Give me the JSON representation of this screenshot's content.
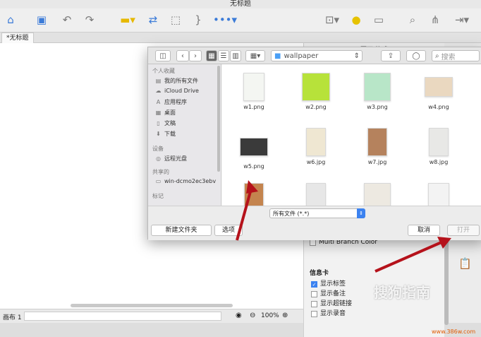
{
  "app": {
    "title": "无标题"
  },
  "doc_tab": {
    "label": "*无标题"
  },
  "status": {
    "canvas_label": "画布 1",
    "zoom": "100%"
  },
  "right_panel": {
    "heading_partial": "页面 格式",
    "branch_option": "Multi Branch Color",
    "info_card_title": "信息卡",
    "checkboxes": [
      {
        "label": "显示标签",
        "checked": true
      },
      {
        "label": "显示备注",
        "checked": false
      },
      {
        "label": "显示超链接",
        "checked": false
      },
      {
        "label": "显示录音",
        "checked": false
      }
    ]
  },
  "dialog": {
    "location": "wallpaper",
    "search_placeholder": "搜索",
    "sidebar": {
      "favorites_header": "个人收藏",
      "favorites": [
        "我的所有文件",
        "iCloud Drive",
        "应用程序",
        "桌面",
        "文稿",
        "下载"
      ],
      "devices_header": "设备",
      "devices": [
        "远程光盘"
      ],
      "shared_header": "共享的",
      "shared": [
        "win-dcmo2ec3ebv"
      ],
      "tags_header": "标记"
    },
    "files": [
      {
        "name": "w1.png",
        "color": "#f4f6f2"
      },
      {
        "name": "w2.png",
        "color": "#b7e23a"
      },
      {
        "name": "w3.png",
        "color": "#b8e6c8"
      },
      {
        "name": "w4.png",
        "color": "#ead8c0"
      },
      {
        "name": "w5.png",
        "color": "#3a3a3a"
      },
      {
        "name": "w6.jpg",
        "color": "#efe7d2"
      },
      {
        "name": "w7.jpg",
        "color": "#b5825d"
      },
      {
        "name": "w8.jpg",
        "color": "#e8e8e6"
      },
      {
        "name": "",
        "color": "#c4844e"
      },
      {
        "name": "",
        "color": "#e7e7e7"
      },
      {
        "name": "",
        "color": "#ede9e1"
      },
      {
        "name": "",
        "color": "#f3f3f3"
      }
    ],
    "filter_value": "所有文件 (*.*)",
    "new_folder_label": "新建文件夹",
    "options_label": "选项",
    "cancel_label": "取消",
    "open_label": "打开"
  },
  "watermark": {
    "text": "搜狗指南",
    "site": "www.386w.com"
  },
  "colors": {
    "accent": "#3b82f0",
    "annotation_arrow": "#b5121b"
  }
}
